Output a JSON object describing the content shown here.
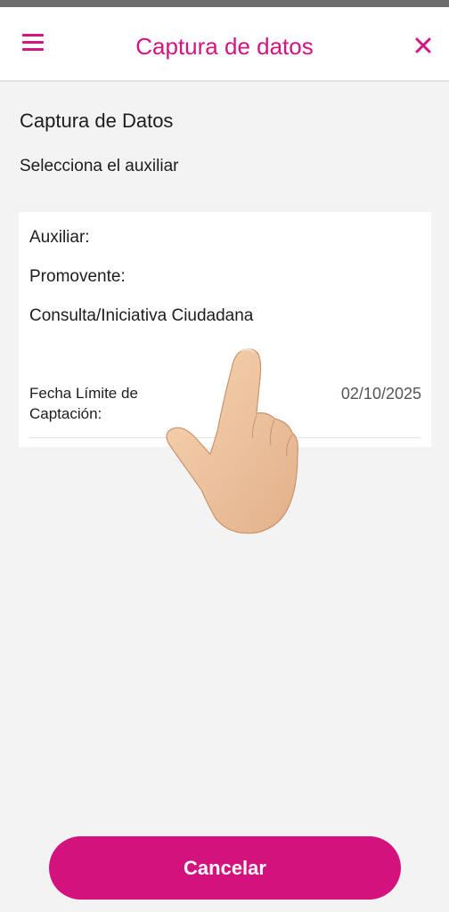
{
  "app_bar": {
    "title": "Captura de datos",
    "menu_icon": "hamburger-menu-icon",
    "close_icon": "close-icon"
  },
  "main": {
    "section_title": "Captura de Datos",
    "section_subtitle": "Selecciona el auxiliar"
  },
  "card": {
    "auxiliar_label": "Auxiliar:",
    "promovente_label": "Promovente:",
    "tipo": "Consulta/Iniciativa Ciudadana",
    "fecha_label": "Fecha Límite de Captación:",
    "fecha_value": "02/10/2025"
  },
  "overlay": {
    "icon": "pointing-hand-icon"
  },
  "footer": {
    "cancel_label": "Cancelar"
  },
  "colors": {
    "accent": "#d4147f",
    "background": "#f3f3f3",
    "card": "#ffffff"
  }
}
